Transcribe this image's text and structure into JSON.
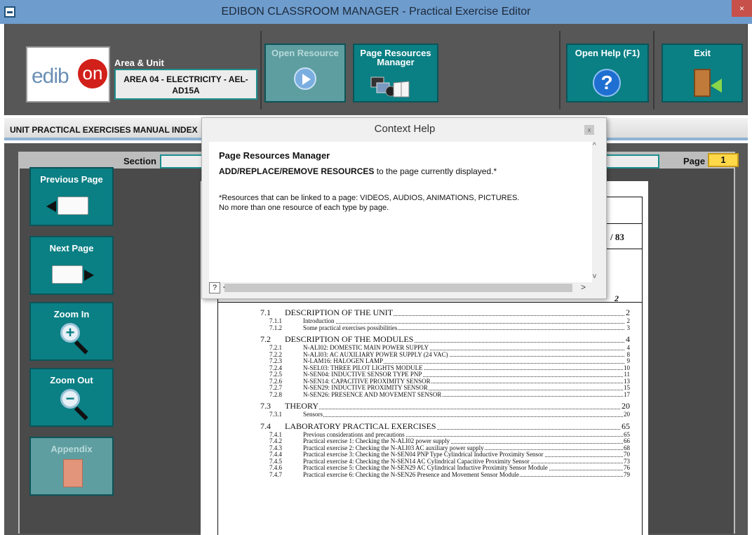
{
  "window": {
    "title": "EDIBON CLASSROOM MANAGER - Practical Exercise Editor",
    "close_glyph": "×"
  },
  "toolbar": {
    "logo_text": "edibon",
    "area_label": "Area & Unit",
    "area_value": "AREA 04 - ELECTRICITY - AEL-AD15A",
    "open_resource": "Open Resource",
    "page_resources_manager": "Page Resources Manager",
    "open_help": "Open Help (F1)",
    "help_glyph": "?",
    "exit": "Exit"
  },
  "index_bar": {
    "title": "UNIT PRACTICAL EXERCISES MANUAL INDEX"
  },
  "main": {
    "section_label": "Section",
    "page_label": "Page",
    "page_value": "1"
  },
  "side_buttons": {
    "previous_page": "Previous Page",
    "next_page": "Next Page",
    "zoom_in": "Zoom In",
    "zoom_out": "Zoom Out",
    "appendix": "Appendix"
  },
  "document": {
    "page_count": "/ 83",
    "top_page": "2",
    "toc": [
      {
        "level": 2,
        "num": "7.1",
        "text": "DESCRIPTION OF THE UNIT",
        "page": "2"
      },
      {
        "level": 3,
        "num": "7.1.1",
        "text": "Introduction",
        "page": "2"
      },
      {
        "level": 3,
        "num": "7.1.2",
        "text": "Some practical exercises possibilities",
        "page": "3"
      },
      {
        "level": 2,
        "num": "7.2",
        "text": "DESCRIPTION OF THE MODULES",
        "page": "4"
      },
      {
        "level": 3,
        "num": "7.2.1",
        "text": "N-ALI02: DOMESTIC MAIN POWER SUPPLY",
        "page": "4"
      },
      {
        "level": 3,
        "num": "7.2.2",
        "text": "N-ALI03: AC AUXILIARY POWER SUPPLY (24 VAC)",
        "page": "8"
      },
      {
        "level": 3,
        "num": "7.2.3",
        "text": "N-LAM16: HALOGEN LAMP",
        "page": "9"
      },
      {
        "level": 3,
        "num": "7.2.4",
        "text": "N-SEL03: THREE PILOT LIGHTS MODULE",
        "page": "10"
      },
      {
        "level": 3,
        "num": "7.2.5",
        "text": "N-SEN04: INDUCTIVE SENSOR TYPE PNP",
        "page": "11"
      },
      {
        "level": 3,
        "num": "7.2.6",
        "text": "N-SEN14: CAPACITIVE PROXIMITY SENSOR",
        "page": "13"
      },
      {
        "level": 3,
        "num": "7.2.7",
        "text": "N-SEN29: INDUCTIVE PROXIMITY SENSOR",
        "page": "15"
      },
      {
        "level": 3,
        "num": "7.2.8",
        "text": "N-SEN26: PRESENCE AND MOVEMENT SENSOR",
        "page": "17"
      },
      {
        "level": 2,
        "num": "7.3",
        "text": "THEORY",
        "page": "20"
      },
      {
        "level": 3,
        "num": "7.3.1",
        "text": "Sensors",
        "page": "20"
      },
      {
        "level": 2,
        "num": "7.4",
        "text": "LABORATORY PRACTICAL EXERCISES",
        "page": "65"
      },
      {
        "level": 3,
        "num": "7.4.1",
        "text": "Previous considerations and precautions",
        "page": "65"
      },
      {
        "level": 3,
        "num": "7.4.2",
        "text": "Practical exercise 1: Checking the N-ALI02 power supply",
        "page": "66"
      },
      {
        "level": 3,
        "num": "7.4.3",
        "text": "Practical exercise 2: Checking the N-ALI03 AC auxiliary power supply",
        "page": "68"
      },
      {
        "level": 3,
        "num": "7.4.4",
        "text": "Practical exercise 3: Checking the N-SEN04 PNP Type Cylindrical Inductive Proximity Sensor",
        "page": "70"
      },
      {
        "level": 3,
        "num": "7.4.5",
        "text": "Practical exercise 4: Checking the N-SEN14 AC Cylindrical Capacitive Proximity Sensor",
        "page": "73"
      },
      {
        "level": 3,
        "num": "7.4.6",
        "text": "Practical exercise 5: Checking the N-SEN29 AC Cylindrical Inductive Proximity Sensor Module",
        "page": "76"
      },
      {
        "level": 3,
        "num": "7.4.7",
        "text": "Practical exercise 6: Checking the N-SEN26 Presence and Movement Sensor Module",
        "page": "79"
      }
    ]
  },
  "context_help": {
    "title": "Context Help",
    "close_glyph": "x",
    "heading": "Page Resources Manager",
    "line1_bold": "ADD/REPLACE/REMOVE RESOURCES",
    "line1_rest": " to the page currently displayed.*",
    "note1": "*Resources that can be linked to a page: VIDEOS, AUDIOS, ANIMATIONS, PICTURES.",
    "note2": "No more than one resource of each type by page.",
    "help_icon_glyph": "?",
    "scroll_up": "^",
    "scroll_down": "v",
    "scroll_left": "<",
    "scroll_right": ">"
  }
}
